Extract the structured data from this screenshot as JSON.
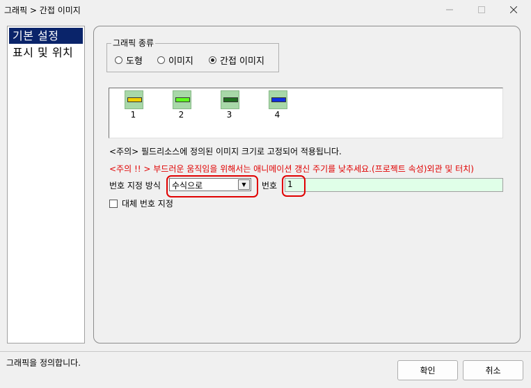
{
  "window": {
    "title": "그래픽 > 간접 이미지"
  },
  "sidebar": {
    "items": [
      {
        "label": "기본 설정"
      },
      {
        "label": "표시 및 위치"
      }
    ]
  },
  "graphic_type": {
    "legend": "그래픽 종류",
    "options": [
      {
        "label": "도형"
      },
      {
        "label": "이미지"
      },
      {
        "label": "간접 이미지"
      }
    ],
    "selected": "간접 이미지"
  },
  "images": [
    {
      "num": "1",
      "color": "#f0d000"
    },
    {
      "num": "2",
      "color": "#60ff20"
    },
    {
      "num": "3",
      "color": "#207020"
    },
    {
      "num": "4",
      "color": "#1030e0"
    }
  ],
  "note": "<주의> 필드리소스에 정의된 이미지 크기로 고정되어 적용됩니다.",
  "warning": "<주의 !! > 부드러운 움직임을 위해서는 애니메이션 갱신 주기를 낮추세요.(프로젝트 속성)외관 및 터치)",
  "number_mode": {
    "label": "번호 지정 방식",
    "value": "수식으로"
  },
  "number": {
    "label": "번호",
    "value": "1"
  },
  "alt_number": {
    "label": "대체 번호 지정"
  },
  "status": "그래픽을 정의합니다.",
  "buttons": {
    "ok": "확인",
    "cancel": "취소"
  }
}
